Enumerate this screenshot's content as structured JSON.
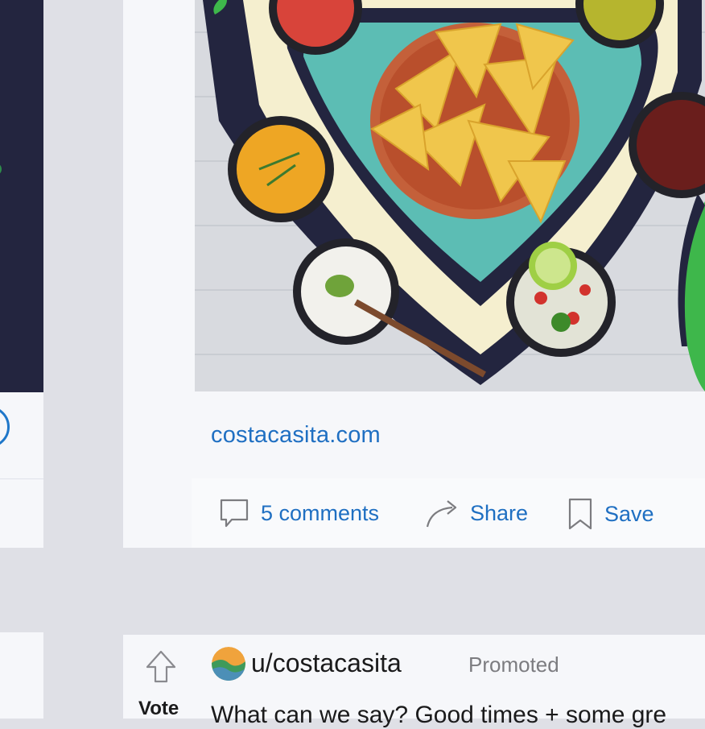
{
  "post": {
    "image_alt": "Nachos bowl surrounded by salsas and dips on heart design",
    "link_text": "costacasita.com",
    "actions": {
      "comments_label": "5 comments",
      "share_label": "Share",
      "save_label": "Save"
    }
  },
  "post2": {
    "vote_label": "Vote",
    "username": "u/costacasita",
    "promoted_label": "Promoted",
    "text": "What can we say? Good times + some gre"
  },
  "colors": {
    "link_blue": "#1f6fc2",
    "navy": "#23253f",
    "card_bg": "#f6f7fa",
    "page_bg": "#dfe0e6"
  },
  "icons": {
    "comments": "comment-icon",
    "share": "share-icon",
    "save": "bookmark-icon",
    "upvote": "upvote-arrow-icon",
    "avatar": "brand-avatar-icon"
  }
}
